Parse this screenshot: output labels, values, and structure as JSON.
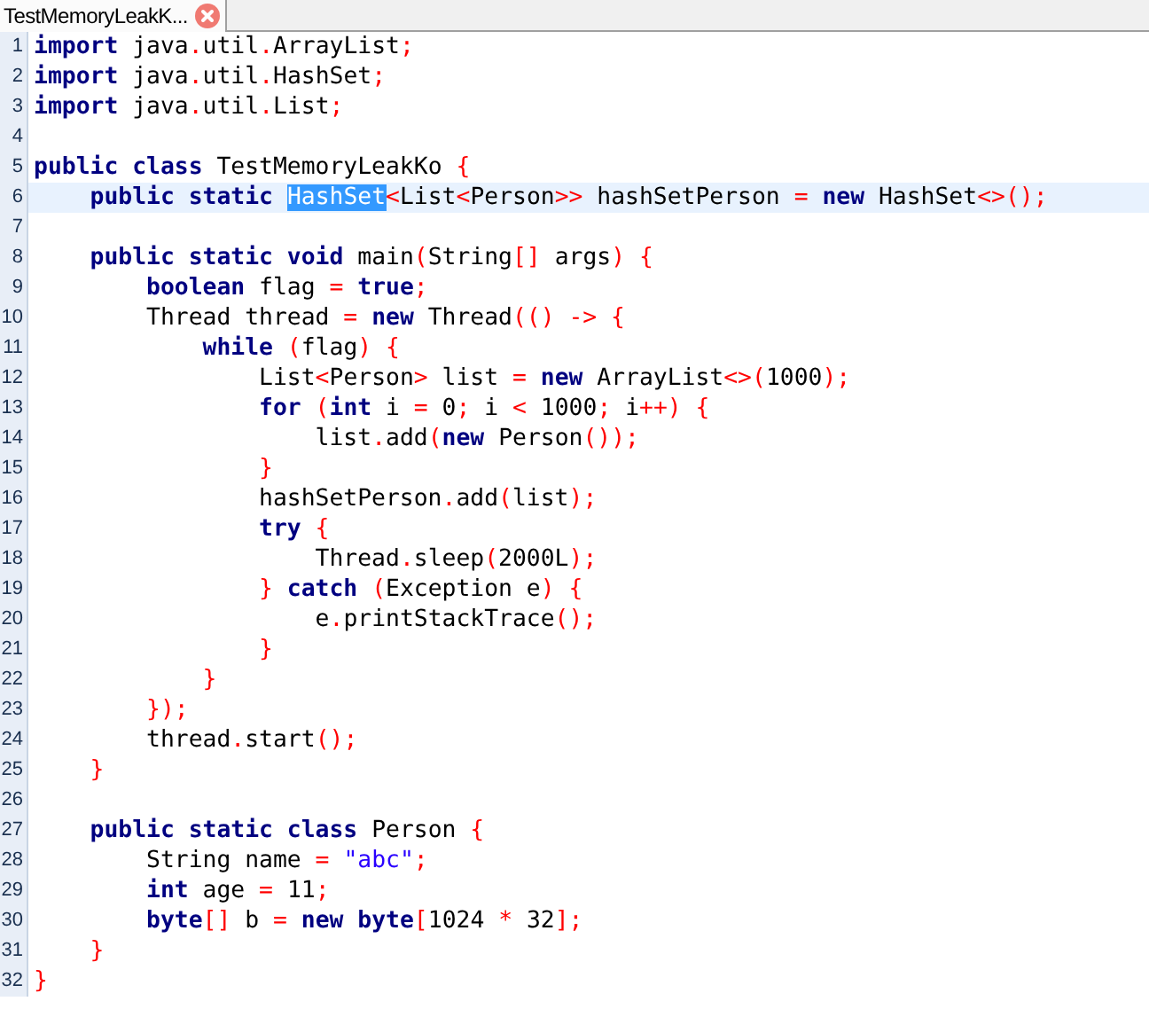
{
  "tabs": [
    {
      "title": "TestMemoryLeakK...",
      "selected": true
    }
  ],
  "editor": {
    "lines": [
      {
        "number": "1",
        "tokens": [
          {
            "kind": "keyword",
            "text": "import"
          },
          {
            "kind": "plain",
            "text": " java"
          },
          {
            "kind": "punct",
            "text": "."
          },
          {
            "kind": "plain",
            "text": "util"
          },
          {
            "kind": "punct",
            "text": "."
          },
          {
            "kind": "plain",
            "text": "ArrayList"
          },
          {
            "kind": "punct",
            "text": ";"
          }
        ]
      },
      {
        "number": "2",
        "tokens": [
          {
            "kind": "keyword",
            "text": "import"
          },
          {
            "kind": "plain",
            "text": " java"
          },
          {
            "kind": "punct",
            "text": "."
          },
          {
            "kind": "plain",
            "text": "util"
          },
          {
            "kind": "punct",
            "text": "."
          },
          {
            "kind": "plain",
            "text": "HashSet"
          },
          {
            "kind": "punct",
            "text": ";"
          }
        ]
      },
      {
        "number": "3",
        "tokens": [
          {
            "kind": "keyword",
            "text": "import"
          },
          {
            "kind": "plain",
            "text": " java"
          },
          {
            "kind": "punct",
            "text": "."
          },
          {
            "kind": "plain",
            "text": "util"
          },
          {
            "kind": "punct",
            "text": "."
          },
          {
            "kind": "plain",
            "text": "List"
          },
          {
            "kind": "punct",
            "text": ";"
          }
        ]
      },
      {
        "number": "4"
      },
      {
        "number": "5",
        "tokens": [
          {
            "kind": "keyword",
            "text": "public"
          },
          {
            "kind": "keyword",
            "text": " class"
          },
          {
            "kind": "plain",
            "text": " TestMemoryLeakKo "
          },
          {
            "kind": "punct",
            "text": "{"
          }
        ]
      },
      {
        "number": "6",
        "current": true,
        "tokens": [
          {
            "kind": "keyword",
            "text": "    public"
          },
          {
            "kind": "keyword",
            "text": " static "
          },
          {
            "kind": "selection",
            "text": "HashSet"
          },
          {
            "kind": "punct",
            "text": "<"
          },
          {
            "kind": "plain",
            "text": "List"
          },
          {
            "kind": "punct",
            "text": "<"
          },
          {
            "kind": "plain",
            "text": "Person"
          },
          {
            "kind": "punct",
            "text": ">>"
          },
          {
            "kind": "plain",
            "text": " hashSetPerson "
          },
          {
            "kind": "punct",
            "text": "="
          },
          {
            "kind": "keyword",
            "text": " new"
          },
          {
            "kind": "plain",
            "text": " HashSet"
          },
          {
            "kind": "punct",
            "text": "<>();"
          }
        ]
      },
      {
        "number": "7"
      },
      {
        "number": "8",
        "tokens": [
          {
            "kind": "keyword",
            "text": "    public"
          },
          {
            "kind": "keyword",
            "text": " static"
          },
          {
            "kind": "keyword",
            "text": " void"
          },
          {
            "kind": "plain",
            "text": " main"
          },
          {
            "kind": "punct",
            "text": "("
          },
          {
            "kind": "plain",
            "text": "String"
          },
          {
            "kind": "punct",
            "text": "[]"
          },
          {
            "kind": "plain",
            "text": " args"
          },
          {
            "kind": "punct",
            "text": ") {"
          }
        ]
      },
      {
        "number": "9",
        "tokens": [
          {
            "kind": "keyword",
            "text": "        boolean"
          },
          {
            "kind": "plain",
            "text": " flag "
          },
          {
            "kind": "punct",
            "text": "="
          },
          {
            "kind": "keyword",
            "text": " true"
          },
          {
            "kind": "punct",
            "text": ";"
          }
        ]
      },
      {
        "number": "10",
        "tokens": [
          {
            "kind": "plain",
            "text": "        Thread thread "
          },
          {
            "kind": "punct",
            "text": "="
          },
          {
            "kind": "keyword",
            "text": " new"
          },
          {
            "kind": "plain",
            "text": " Thread"
          },
          {
            "kind": "punct",
            "text": "(() -> {"
          }
        ]
      },
      {
        "number": "11",
        "tokens": [
          {
            "kind": "keyword",
            "text": "            while"
          },
          {
            "kind": "punct",
            "text": " ("
          },
          {
            "kind": "plain",
            "text": "flag"
          },
          {
            "kind": "punct",
            "text": ") {"
          }
        ]
      },
      {
        "number": "12",
        "tokens": [
          {
            "kind": "plain",
            "text": "                List"
          },
          {
            "kind": "punct",
            "text": "<"
          },
          {
            "kind": "plain",
            "text": "Person"
          },
          {
            "kind": "punct",
            "text": ">"
          },
          {
            "kind": "plain",
            "text": " list "
          },
          {
            "kind": "punct",
            "text": "="
          },
          {
            "kind": "keyword",
            "text": " new"
          },
          {
            "kind": "plain",
            "text": " ArrayList"
          },
          {
            "kind": "punct",
            "text": "<>("
          },
          {
            "kind": "plain",
            "text": "1000"
          },
          {
            "kind": "punct",
            "text": ");"
          }
        ]
      },
      {
        "number": "13",
        "tokens": [
          {
            "kind": "keyword",
            "text": "                for"
          },
          {
            "kind": "punct",
            "text": " ("
          },
          {
            "kind": "keyword",
            "text": "int"
          },
          {
            "kind": "plain",
            "text": " i "
          },
          {
            "kind": "punct",
            "text": "="
          },
          {
            "kind": "plain",
            "text": " 0"
          },
          {
            "kind": "punct",
            "text": ";"
          },
          {
            "kind": "plain",
            "text": " i "
          },
          {
            "kind": "punct",
            "text": "<"
          },
          {
            "kind": "plain",
            "text": " 1000"
          },
          {
            "kind": "punct",
            "text": ";"
          },
          {
            "kind": "plain",
            "text": " i"
          },
          {
            "kind": "punct",
            "text": "++) {"
          }
        ]
      },
      {
        "number": "14",
        "tokens": [
          {
            "kind": "plain",
            "text": "                    list"
          },
          {
            "kind": "punct",
            "text": "."
          },
          {
            "kind": "plain",
            "text": "add"
          },
          {
            "kind": "punct",
            "text": "("
          },
          {
            "kind": "keyword",
            "text": "new"
          },
          {
            "kind": "plain",
            "text": " Person"
          },
          {
            "kind": "punct",
            "text": "());"
          }
        ]
      },
      {
        "number": "15",
        "tokens": [
          {
            "kind": "punct",
            "text": "                }"
          }
        ]
      },
      {
        "number": "16",
        "tokens": [
          {
            "kind": "plain",
            "text": "                hashSetPerson"
          },
          {
            "kind": "punct",
            "text": "."
          },
          {
            "kind": "plain",
            "text": "add"
          },
          {
            "kind": "punct",
            "text": "("
          },
          {
            "kind": "plain",
            "text": "list"
          },
          {
            "kind": "punct",
            "text": ");"
          }
        ]
      },
      {
        "number": "17",
        "tokens": [
          {
            "kind": "keyword",
            "text": "                try"
          },
          {
            "kind": "punct",
            "text": " {"
          }
        ]
      },
      {
        "number": "18",
        "tokens": [
          {
            "kind": "plain",
            "text": "                    Thread"
          },
          {
            "kind": "punct",
            "text": "."
          },
          {
            "kind": "plain",
            "text": "sleep"
          },
          {
            "kind": "punct",
            "text": "("
          },
          {
            "kind": "plain",
            "text": "2000L"
          },
          {
            "kind": "punct",
            "text": ");"
          }
        ]
      },
      {
        "number": "19",
        "tokens": [
          {
            "kind": "punct",
            "text": "                }"
          },
          {
            "kind": "keyword",
            "text": " catch"
          },
          {
            "kind": "punct",
            "text": " ("
          },
          {
            "kind": "plain",
            "text": "Exception e"
          },
          {
            "kind": "punct",
            "text": ") {"
          }
        ]
      },
      {
        "number": "20",
        "tokens": [
          {
            "kind": "plain",
            "text": "                    e"
          },
          {
            "kind": "punct",
            "text": "."
          },
          {
            "kind": "plain",
            "text": "printStackTrace"
          },
          {
            "kind": "punct",
            "text": "();"
          }
        ]
      },
      {
        "number": "21",
        "tokens": [
          {
            "kind": "punct",
            "text": "                }"
          }
        ]
      },
      {
        "number": "22",
        "tokens": [
          {
            "kind": "punct",
            "text": "            }"
          }
        ]
      },
      {
        "number": "23",
        "tokens": [
          {
            "kind": "punct",
            "text": "        });"
          }
        ]
      },
      {
        "number": "24",
        "tokens": [
          {
            "kind": "plain",
            "text": "        thread"
          },
          {
            "kind": "punct",
            "text": "."
          },
          {
            "kind": "plain",
            "text": "start"
          },
          {
            "kind": "punct",
            "text": "();"
          }
        ]
      },
      {
        "number": "25",
        "tokens": [
          {
            "kind": "punct",
            "text": "    }"
          }
        ]
      },
      {
        "number": "26"
      },
      {
        "number": "27",
        "tokens": [
          {
            "kind": "keyword",
            "text": "    public"
          },
          {
            "kind": "keyword",
            "text": " static"
          },
          {
            "kind": "keyword",
            "text": " class"
          },
          {
            "kind": "plain",
            "text": " Person "
          },
          {
            "kind": "punct",
            "text": "{"
          }
        ]
      },
      {
        "number": "28",
        "tokens": [
          {
            "kind": "plain",
            "text": "        String name "
          },
          {
            "kind": "punct",
            "text": "="
          },
          {
            "kind": "string",
            "text": " \"abc\""
          },
          {
            "kind": "punct",
            "text": ";"
          }
        ]
      },
      {
        "number": "29",
        "tokens": [
          {
            "kind": "keyword",
            "text": "        int"
          },
          {
            "kind": "plain",
            "text": " age "
          },
          {
            "kind": "punct",
            "text": "="
          },
          {
            "kind": "plain",
            "text": " 11"
          },
          {
            "kind": "punct",
            "text": ";"
          }
        ]
      },
      {
        "number": "30",
        "tokens": [
          {
            "kind": "keyword",
            "text": "        byte"
          },
          {
            "kind": "punct",
            "text": "[]"
          },
          {
            "kind": "plain",
            "text": " b "
          },
          {
            "kind": "punct",
            "text": "="
          },
          {
            "kind": "keyword",
            "text": " new"
          },
          {
            "kind": "keyword",
            "text": " byte"
          },
          {
            "kind": "punct",
            "text": "["
          },
          {
            "kind": "plain",
            "text": "1024 "
          },
          {
            "kind": "punct",
            "text": "*"
          },
          {
            "kind": "plain",
            "text": " 32"
          },
          {
            "kind": "punct",
            "text": "];"
          }
        ]
      },
      {
        "number": "31",
        "tokens": [
          {
            "kind": "punct",
            "text": "    }"
          }
        ]
      },
      {
        "number": "32",
        "tokens": [
          {
            "kind": "punct",
            "text": "}"
          }
        ]
      }
    ]
  }
}
